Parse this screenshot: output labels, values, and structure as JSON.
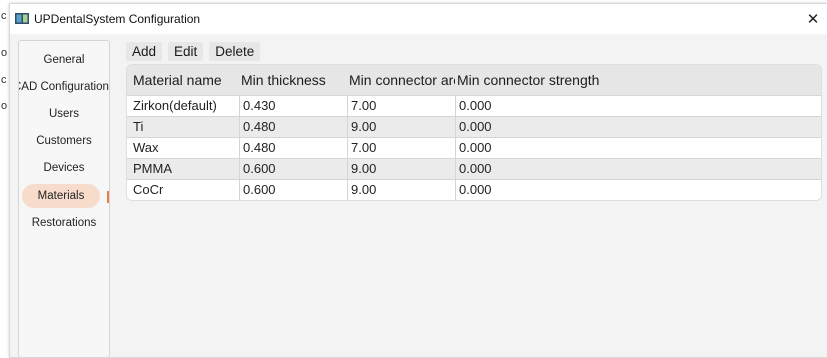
{
  "edge_letters": [
    "c",
    "o",
    "c",
    "o",
    "c"
  ],
  "window": {
    "title": "UPDentalSystem Configuration",
    "close_glyph": "✕"
  },
  "sidebar": {
    "items": [
      {
        "label": "General"
      },
      {
        "label": "CAD Configuration"
      },
      {
        "label": "Users"
      },
      {
        "label": "Customers"
      },
      {
        "label": "Devices"
      },
      {
        "label": "Materials",
        "selected": true
      },
      {
        "label": "Restorations"
      }
    ]
  },
  "toolbar": {
    "add_label": "Add",
    "edit_label": "Edit",
    "delete_label": "Delete"
  },
  "table": {
    "columns": [
      "Material name",
      "Min thickness",
      "Min connector area",
      "Min connector strength"
    ],
    "rows": [
      [
        "Zirkon(default)",
        "0.430",
        "7.00",
        "0.000"
      ],
      [
        "Ti",
        "0.480",
        "9.00",
        "0.000"
      ],
      [
        "Wax",
        "0.480",
        "7.00",
        "0.000"
      ],
      [
        "PMMA",
        "0.600",
        "9.00",
        "0.000"
      ],
      [
        "CoCr",
        "0.600",
        "9.00",
        "0.000"
      ]
    ]
  },
  "colors": {
    "selected_bg": "#f8dccb",
    "selected_marker": "#e87f46"
  }
}
